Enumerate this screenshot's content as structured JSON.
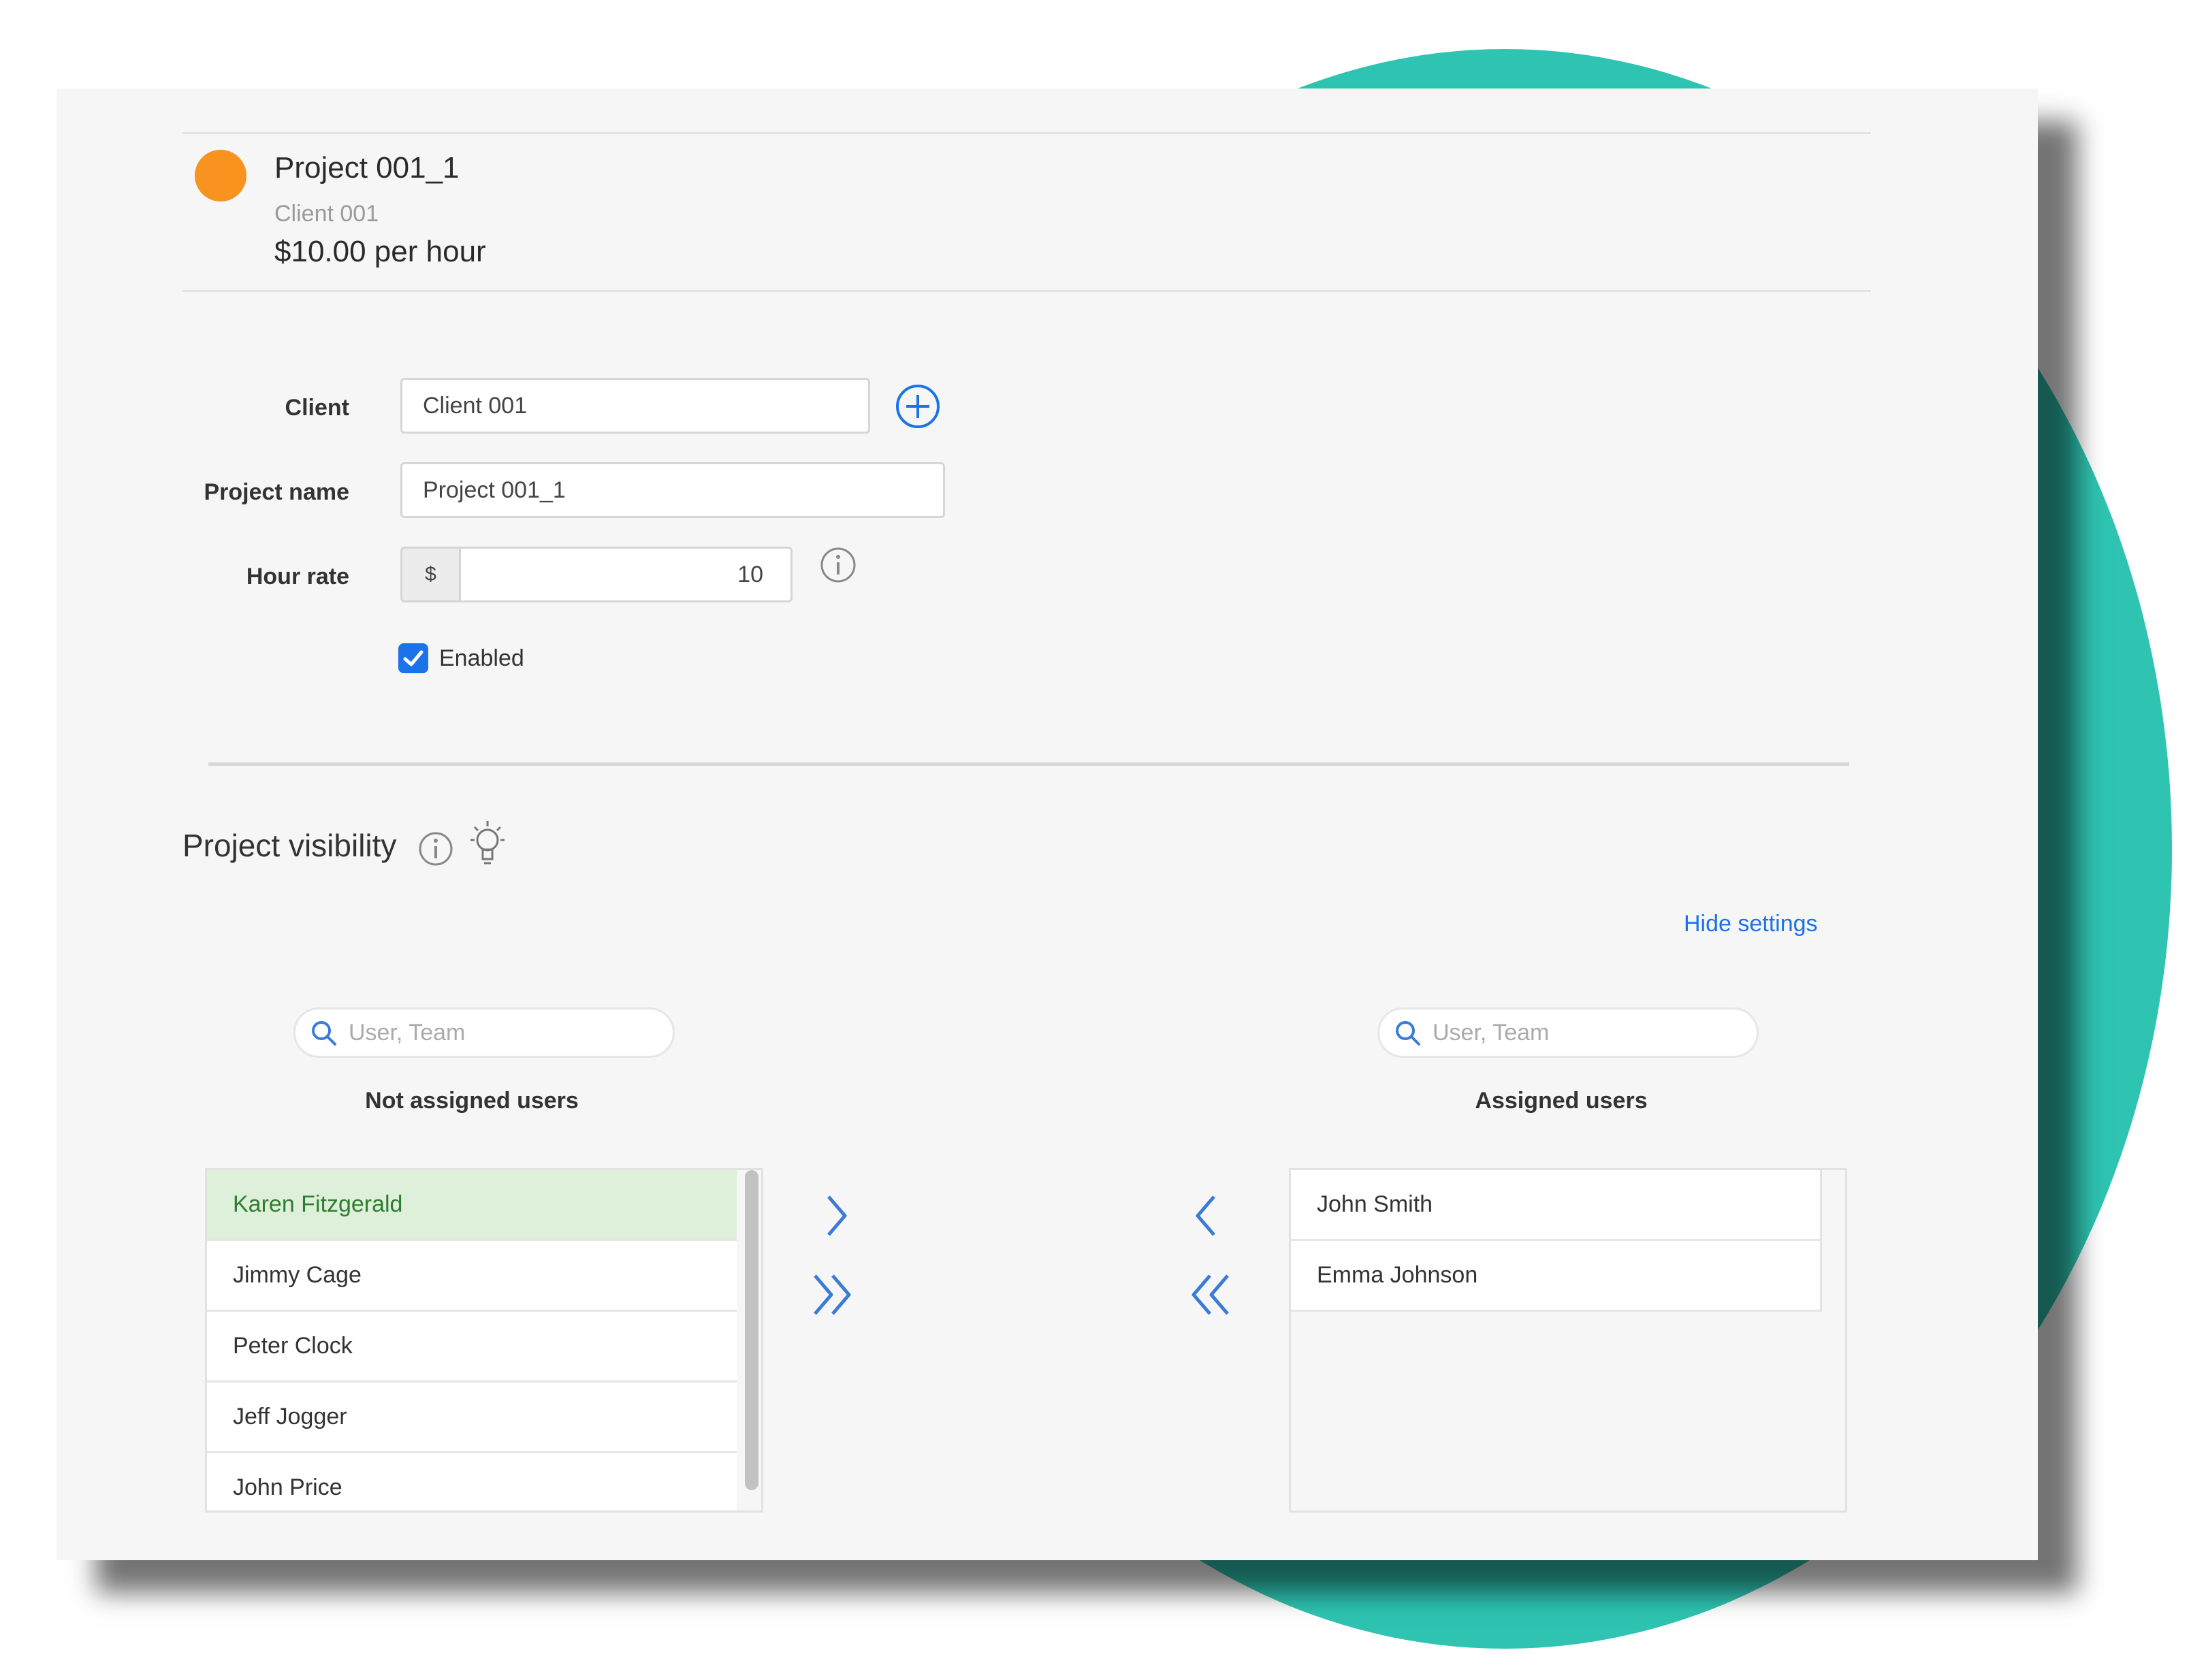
{
  "project": {
    "color": "#f7931e",
    "title": "Project 001_1",
    "client": "Client 001",
    "rate": "$10.00 per hour"
  },
  "form": {
    "client_label": "Client",
    "client_value": "Client 001",
    "project_name_label": "Project name",
    "project_name_value": "Project 001_1",
    "hour_rate_label": "Hour rate",
    "currency_symbol": "$",
    "hour_rate_value": "10",
    "enabled_label": "Enabled",
    "enabled_checked": true
  },
  "visibility": {
    "title": "Project visibility",
    "hide_settings": "Hide settings",
    "left_search_placeholder": "User, Team",
    "right_search_placeholder": "User, Team",
    "not_assigned_title": "Not assigned users",
    "assigned_title": "Assigned users",
    "not_assigned": [
      "Karen Fitzgerald",
      "Jimmy Cage",
      "Peter Clock",
      "Jeff Jogger",
      "John Price"
    ],
    "assigned": [
      "John Smith",
      "Emma Johnson"
    ]
  },
  "colors": {
    "accent": "#1a73e8",
    "background_circle": "#2ec4b1",
    "selected_row": "#dff0da"
  },
  "icons": [
    "add-client-icon",
    "info-icon",
    "lightbulb-icon",
    "search-icon",
    "chevron-right-icon",
    "double-chevron-right-icon",
    "chevron-left-icon",
    "double-chevron-left-icon",
    "checkmark-icon"
  ]
}
